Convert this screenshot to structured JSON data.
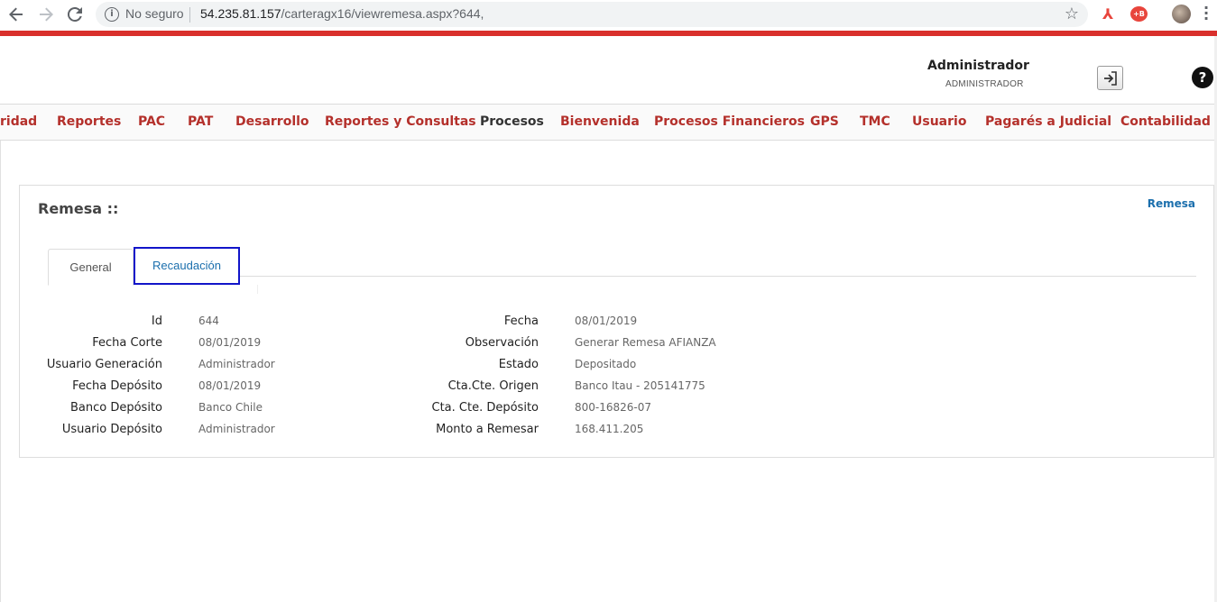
{
  "browser": {
    "security_label": "No seguro",
    "url_host": "54.235.81.157",
    "url_path": "/carteragx16/viewremesa.aspx?644,",
    "info_icon": "info-icon",
    "star_icon": "star-icon",
    "back_icon": "arrow-left-icon",
    "forward_icon": "arrow-right-icon",
    "reload_icon": "reload-icon",
    "ext_red_label": "+B"
  },
  "header": {
    "user_name": "Administrador",
    "user_role": "ADMINISTRADOR",
    "logout_icon": "logout-icon",
    "help_label": "?"
  },
  "menu": {
    "items": [
      {
        "label": "ridad"
      },
      {
        "label": "Reportes"
      },
      {
        "label": "PAC"
      },
      {
        "label": "PAT"
      },
      {
        "label": "Desarrollo"
      },
      {
        "label": "Reportes y Consultas"
      },
      {
        "label": "Procesos"
      },
      {
        "label": "Bienvenida"
      },
      {
        "label": "Procesos Financieros"
      },
      {
        "label": "GPS"
      },
      {
        "label": "TMC"
      },
      {
        "label": "Usuario"
      },
      {
        "label": "Pagarés a Judicial"
      },
      {
        "label": "Contabilidad"
      }
    ],
    "colors": {
      "accent": "#b4302b",
      "active": "#333333"
    }
  },
  "panel": {
    "title": "Remesa ::",
    "link": "Remesa",
    "tabs": [
      {
        "label": "General"
      },
      {
        "label": "Recaudación"
      }
    ]
  },
  "fields_left": [
    {
      "label": "Id",
      "value": "644"
    },
    {
      "label": "Fecha Corte",
      "value": "08/01/2019"
    },
    {
      "label": "Usuario Generación",
      "value": "Administrador"
    },
    {
      "label": "Fecha Depósito",
      "value": "08/01/2019"
    },
    {
      "label": "Banco Depósito",
      "value": "Banco Chile"
    },
    {
      "label": "Usuario Depósito",
      "value": "Administrador"
    }
  ],
  "fields_right": [
    {
      "label": "Fecha",
      "value": "08/01/2019"
    },
    {
      "label": "Observación",
      "value": "Generar Remesa AFIANZA"
    },
    {
      "label": "Estado",
      "value": "Depositado"
    },
    {
      "label": "Cta.Cte. Origen",
      "value": "Banco Itau - 205141775"
    },
    {
      "label": "Cta. Cte. Depósito",
      "value": "800-16826-07"
    },
    {
      "label": "Monto a Remesar",
      "value": "168.411.205"
    }
  ]
}
